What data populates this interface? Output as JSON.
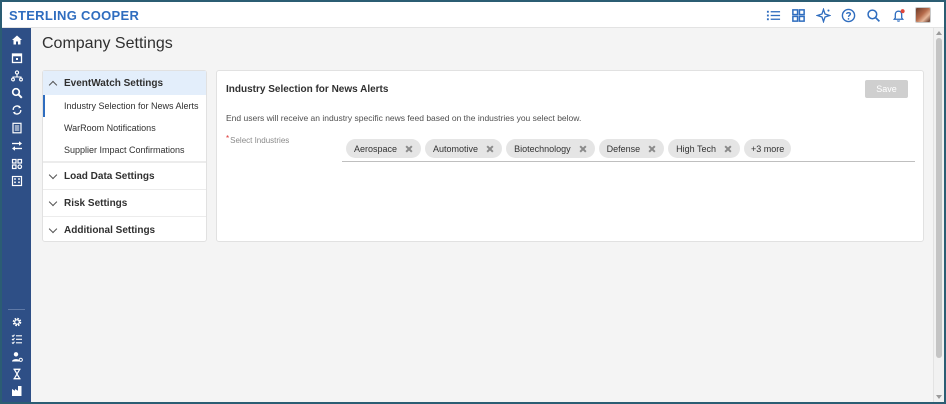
{
  "brand": "STERLING COOPER",
  "page_title": "Company Settings",
  "topbar_icons": [
    "list-icon",
    "grid-icon",
    "sparkle-icon",
    "help-icon",
    "search-icon",
    "bell-icon"
  ],
  "rail_icons_top": [
    "home-icon",
    "calendar-icon",
    "network-icon",
    "search-icon",
    "sync-icon",
    "document-icon",
    "transfer-icon",
    "apps-icon",
    "building-icon"
  ],
  "rail_icons_bottom": [
    "gear-icon",
    "checklist-icon",
    "user-gear-icon",
    "hourglass-icon",
    "factory-icon"
  ],
  "nav": {
    "eventwatch": {
      "label": "EventWatch Settings",
      "items": [
        "Industry Selection for News Alerts",
        "WarRoom Notifications",
        "Supplier Impact Confirmations"
      ]
    },
    "load_data": "Load Data Settings",
    "risk": "Risk Settings",
    "additional": "Additional Settings"
  },
  "card": {
    "title": "Industry Selection for News Alerts",
    "save_label": "Save",
    "description": "End users will receive an industry specific news feed based on the industries you select below.",
    "field_required_mark": "*",
    "field_label": "Select Industries",
    "chips": [
      "Aerospace",
      "Automotive",
      "Biotechnology",
      "Defense",
      "High Tech"
    ],
    "more_label": "+3 more"
  },
  "colors": {
    "brand": "#2f6dbf",
    "rail": "#2e4f86",
    "active_nav_bg": "#e3eefb"
  }
}
